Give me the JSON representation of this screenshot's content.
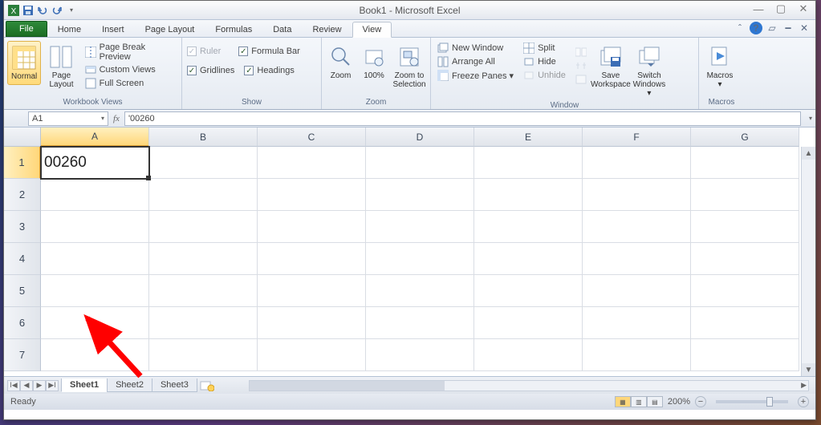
{
  "window_title": "Book1 - Microsoft Excel",
  "tabs": {
    "file": "File",
    "home": "Home",
    "insert": "Insert",
    "page_layout": "Page Layout",
    "formulas": "Formulas",
    "data": "Data",
    "review": "Review",
    "view": "View"
  },
  "ribbon": {
    "workbook_views": {
      "label": "Workbook Views",
      "normal": "Normal",
      "page_layout": "Page\nLayout",
      "page_break": "Page Break Preview",
      "custom": "Custom Views",
      "full": "Full Screen"
    },
    "show": {
      "label": "Show",
      "ruler": "Ruler",
      "formula_bar": "Formula Bar",
      "gridlines": "Gridlines",
      "headings": "Headings"
    },
    "zoom": {
      "label": "Zoom",
      "zoom": "Zoom",
      "hundred": "100%",
      "selection": "Zoom to\nSelection"
    },
    "window": {
      "label": "Window",
      "new_window": "New Window",
      "arrange_all": "Arrange All",
      "freeze": "Freeze Panes ▾",
      "split": "Split",
      "hide": "Hide",
      "unhide": "Unhide",
      "save_ws": "Save\nWorkspace",
      "switch": "Switch\nWindows ▾"
    },
    "macros": {
      "label": "Macros",
      "macros": "Macros\n▾"
    }
  },
  "namebox": "A1",
  "formula_bar": "'00260",
  "columns": [
    "A",
    "B",
    "C",
    "D",
    "E",
    "F",
    "G"
  ],
  "rows": [
    "1",
    "2",
    "3",
    "4",
    "5",
    "6",
    "7"
  ],
  "cells": {
    "A1": "00260"
  },
  "sheets": [
    "Sheet1",
    "Sheet2",
    "Sheet3"
  ],
  "status": {
    "ready": "Ready",
    "zoom": "200%"
  }
}
